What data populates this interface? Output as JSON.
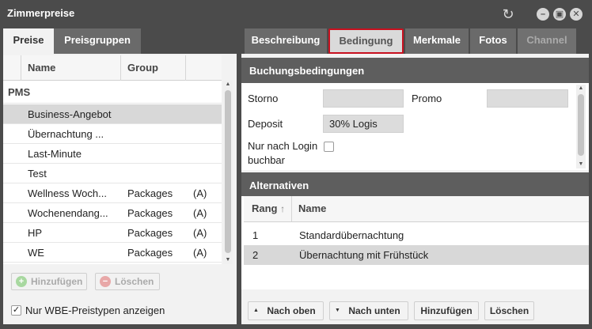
{
  "window": {
    "title": "Zimmerpreise",
    "refresh_icon": "refresh-icon",
    "minimize_icon": "minimize-icon",
    "restore_icon": "restore-icon",
    "close_icon": "close-icon"
  },
  "left": {
    "tabs": [
      {
        "label": "Preise",
        "active": true
      },
      {
        "label": "Preisgruppen",
        "active": false
      }
    ],
    "columns": [
      "Name",
      "Group"
    ],
    "group_label": "PMS",
    "rows": [
      {
        "name": "Business-Angebot",
        "group": "",
        "flag": "",
        "selected": true
      },
      {
        "name": "Übernachtung ...",
        "group": "",
        "flag": "",
        "selected": false
      },
      {
        "name": "Last-Minute",
        "group": "",
        "flag": "",
        "selected": false
      },
      {
        "name": "Test",
        "group": "",
        "flag": "",
        "selected": false
      },
      {
        "name": "Wellness Woch...",
        "group": "Packages",
        "flag": "(A)",
        "selected": false
      },
      {
        "name": "Wochenendang...",
        "group": "Packages",
        "flag": "(A)",
        "selected": false
      },
      {
        "name": "HP",
        "group": "Packages",
        "flag": "(A)",
        "selected": false
      },
      {
        "name": "WE",
        "group": "Packages",
        "flag": "(A)",
        "selected": false
      }
    ],
    "add_label": "Hinzufügen",
    "delete_label": "Löschen",
    "filter_label": "Nur WBE-Preistypen anzeigen",
    "filter_checked": true
  },
  "right": {
    "tabs": [
      {
        "label": "Beschreibung",
        "state": "normal"
      },
      {
        "label": "Bedingung",
        "state": "active"
      },
      {
        "label": "Merkmale",
        "state": "normal"
      },
      {
        "label": "Fotos",
        "state": "normal"
      },
      {
        "label": "Channel",
        "state": "disabled"
      }
    ],
    "booking": {
      "title": "Buchungsbedingungen",
      "storno_label": "Storno",
      "storno_value": "",
      "promo_label": "Promo",
      "promo_value": "",
      "deposit_label": "Deposit",
      "deposit_value": "30% Logis",
      "login_label_1": "Nur nach Login",
      "login_label_2": "buchbar",
      "login_checked": false
    },
    "alternatives": {
      "title": "Alternativen",
      "columns": [
        "Rang",
        "Name"
      ],
      "sort_icon": "sort-up-icon",
      "rows": [
        {
          "rank": "1",
          "name": "Standardübernachtung",
          "selected": false
        },
        {
          "rank": "2",
          "name": "Übernachtung mit Frühstück",
          "selected": true
        }
      ]
    },
    "buttons": {
      "up": "Nach oben",
      "down": "Nach unten",
      "add": "Hinzufügen",
      "delete": "Löschen"
    }
  },
  "colors": {
    "highlight_border": "#c8101f",
    "panel_bg": "#f2f2f2",
    "window_bg": "#4b4b4b",
    "section_header": "#5e5e5e"
  }
}
